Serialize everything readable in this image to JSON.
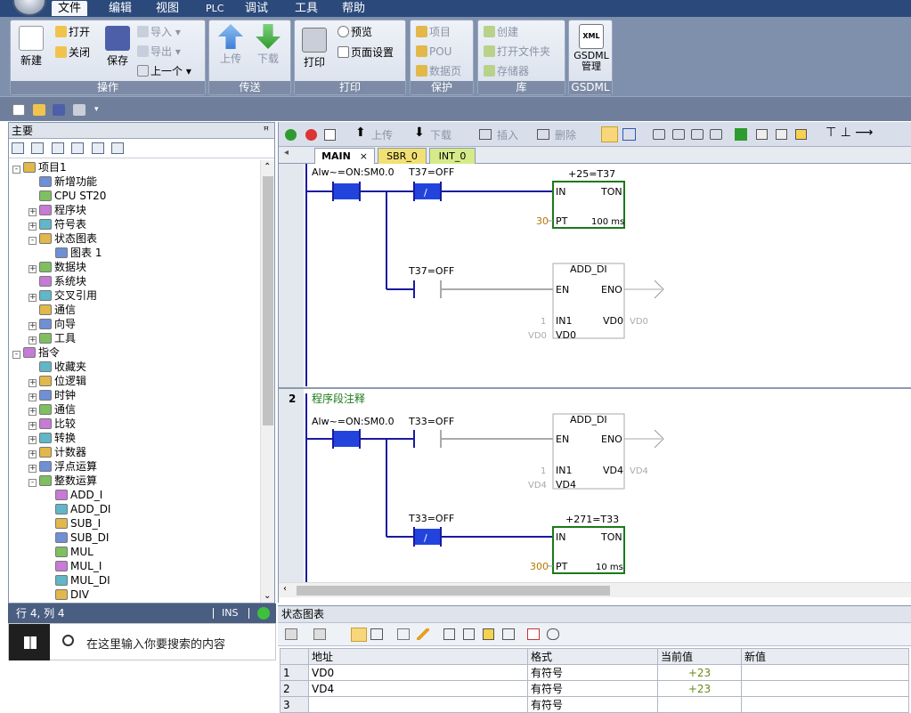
{
  "menubar": {
    "items": [
      "文件",
      "编辑",
      "视图",
      "PLC",
      "调试",
      "工具",
      "帮助"
    ]
  },
  "ribbon": {
    "groups": {
      "operate": {
        "title": "操作",
        "new": "新建",
        "open": "打开",
        "close": "关闭",
        "save": "保存",
        "import": "导入",
        "export": "导出",
        "previous": "上一个"
      },
      "transfer": {
        "title": "传送",
        "upload": "上传",
        "download": "下载"
      },
      "print": {
        "title": "打印",
        "print": "打印",
        "preview": "预览",
        "page_setup": "页面设置"
      },
      "protect": {
        "title": "保护",
        "project": "项目",
        "pou": "POU",
        "data_page": "数据页"
      },
      "library": {
        "title": "库",
        "create": "创建",
        "open_folder": "打开文件夹",
        "memory": "存储器"
      },
      "gsdml": {
        "title": "GSDML",
        "manage_1": "GSDML",
        "manage_2": "管理",
        "icon_text": "XML"
      }
    }
  },
  "left_panel": {
    "title": "主要",
    "pin": "ꟸ",
    "tree": [
      {
        "label": "项目1",
        "level": 0,
        "box": "-"
      },
      {
        "label": "新增功能",
        "level": 1,
        "box": ""
      },
      {
        "label": "CPU ST20",
        "level": 1,
        "box": ""
      },
      {
        "label": "程序块",
        "level": 1,
        "box": "+"
      },
      {
        "label": "符号表",
        "level": 1,
        "box": "+"
      },
      {
        "label": "状态图表",
        "level": 1,
        "box": "-"
      },
      {
        "label": "图表 1",
        "level": 2,
        "box": ""
      },
      {
        "label": "数据块",
        "level": 1,
        "box": "+"
      },
      {
        "label": "系统块",
        "level": 1,
        "box": ""
      },
      {
        "label": "交叉引用",
        "level": 1,
        "box": "+"
      },
      {
        "label": "通信",
        "level": 1,
        "box": ""
      },
      {
        "label": "向导",
        "level": 1,
        "box": "+"
      },
      {
        "label": "工具",
        "level": 1,
        "box": "+"
      },
      {
        "label": "指令",
        "level": 0,
        "box": "-"
      },
      {
        "label": "收藏夹",
        "level": 1,
        "box": ""
      },
      {
        "label": "位逻辑",
        "level": 1,
        "box": "+"
      },
      {
        "label": "时钟",
        "level": 1,
        "box": "+"
      },
      {
        "label": "通信",
        "level": 1,
        "box": "+"
      },
      {
        "label": "比较",
        "level": 1,
        "box": "+"
      },
      {
        "label": "转换",
        "level": 1,
        "box": "+"
      },
      {
        "label": "计数器",
        "level": 1,
        "box": "+"
      },
      {
        "label": "浮点运算",
        "level": 1,
        "box": "+"
      },
      {
        "label": "整数运算",
        "level": 1,
        "box": "-"
      },
      {
        "label": "ADD_I",
        "level": 2,
        "box": ""
      },
      {
        "label": "ADD_DI",
        "level": 2,
        "box": ""
      },
      {
        "label": "SUB_I",
        "level": 2,
        "box": ""
      },
      {
        "label": "SUB_DI",
        "level": 2,
        "box": ""
      },
      {
        "label": "MUL",
        "level": 2,
        "box": ""
      },
      {
        "label": "MUL_I",
        "level": 2,
        "box": ""
      },
      {
        "label": "MUL_DI",
        "level": 2,
        "box": ""
      },
      {
        "label": "DIV",
        "level": 2,
        "box": ""
      }
    ]
  },
  "statusbar": {
    "position": "行 4, 列 4",
    "mode": "INS"
  },
  "taskbar": {
    "search_placeholder": "在这里输入你要搜索的内容"
  },
  "editor": {
    "toolbar": {
      "upload": "上传",
      "download": "下载",
      "insert": "插入",
      "delete": "删除"
    },
    "tabs": [
      "MAIN",
      "SBR_0",
      "INT_0"
    ],
    "tab_close": "×",
    "network2": {
      "number": "2",
      "comment": "程序段注释"
    },
    "ladder": {
      "contact_sm": "Alw~=ON:SM0.0",
      "contact_t37": "T37=OFF",
      "contact_t33": "T33=OFF",
      "timer1_title": "+25=T37",
      "timer1_preset": "30",
      "timer1_base": "100 ms",
      "timer2_title": "+271=T33",
      "timer2_preset": "300",
      "timer2_base": "10 ms",
      "ton": "TON",
      "in": "IN",
      "pt": "PT",
      "add_di": "ADD_DI",
      "en": "EN",
      "eno": "ENO",
      "in1": "IN1",
      "in2_vd0": "VD0",
      "in2_vd4": "VD4",
      "one": "1",
      "vd0": "VD0",
      "vd4": "VD4",
      "not": "/"
    }
  },
  "status_chart": {
    "title": "状态图表",
    "columns": [
      "",
      "地址",
      "格式",
      "当前值",
      "新值"
    ],
    "rows": [
      {
        "n": "1",
        "addr": "VD0",
        "fmt": "有符号",
        "cur": "+23",
        "new": ""
      },
      {
        "n": "2",
        "addr": "VD4",
        "fmt": "有符号",
        "cur": "+23",
        "new": ""
      },
      {
        "n": "3",
        "addr": "",
        "fmt": "有符号",
        "cur": "",
        "new": ""
      }
    ]
  },
  "colors": {
    "contact_fill": "#2244dd",
    "box_border": "#1a7a1a",
    "live_value": "#b07a00",
    "inactive": "#aaaaaa"
  }
}
